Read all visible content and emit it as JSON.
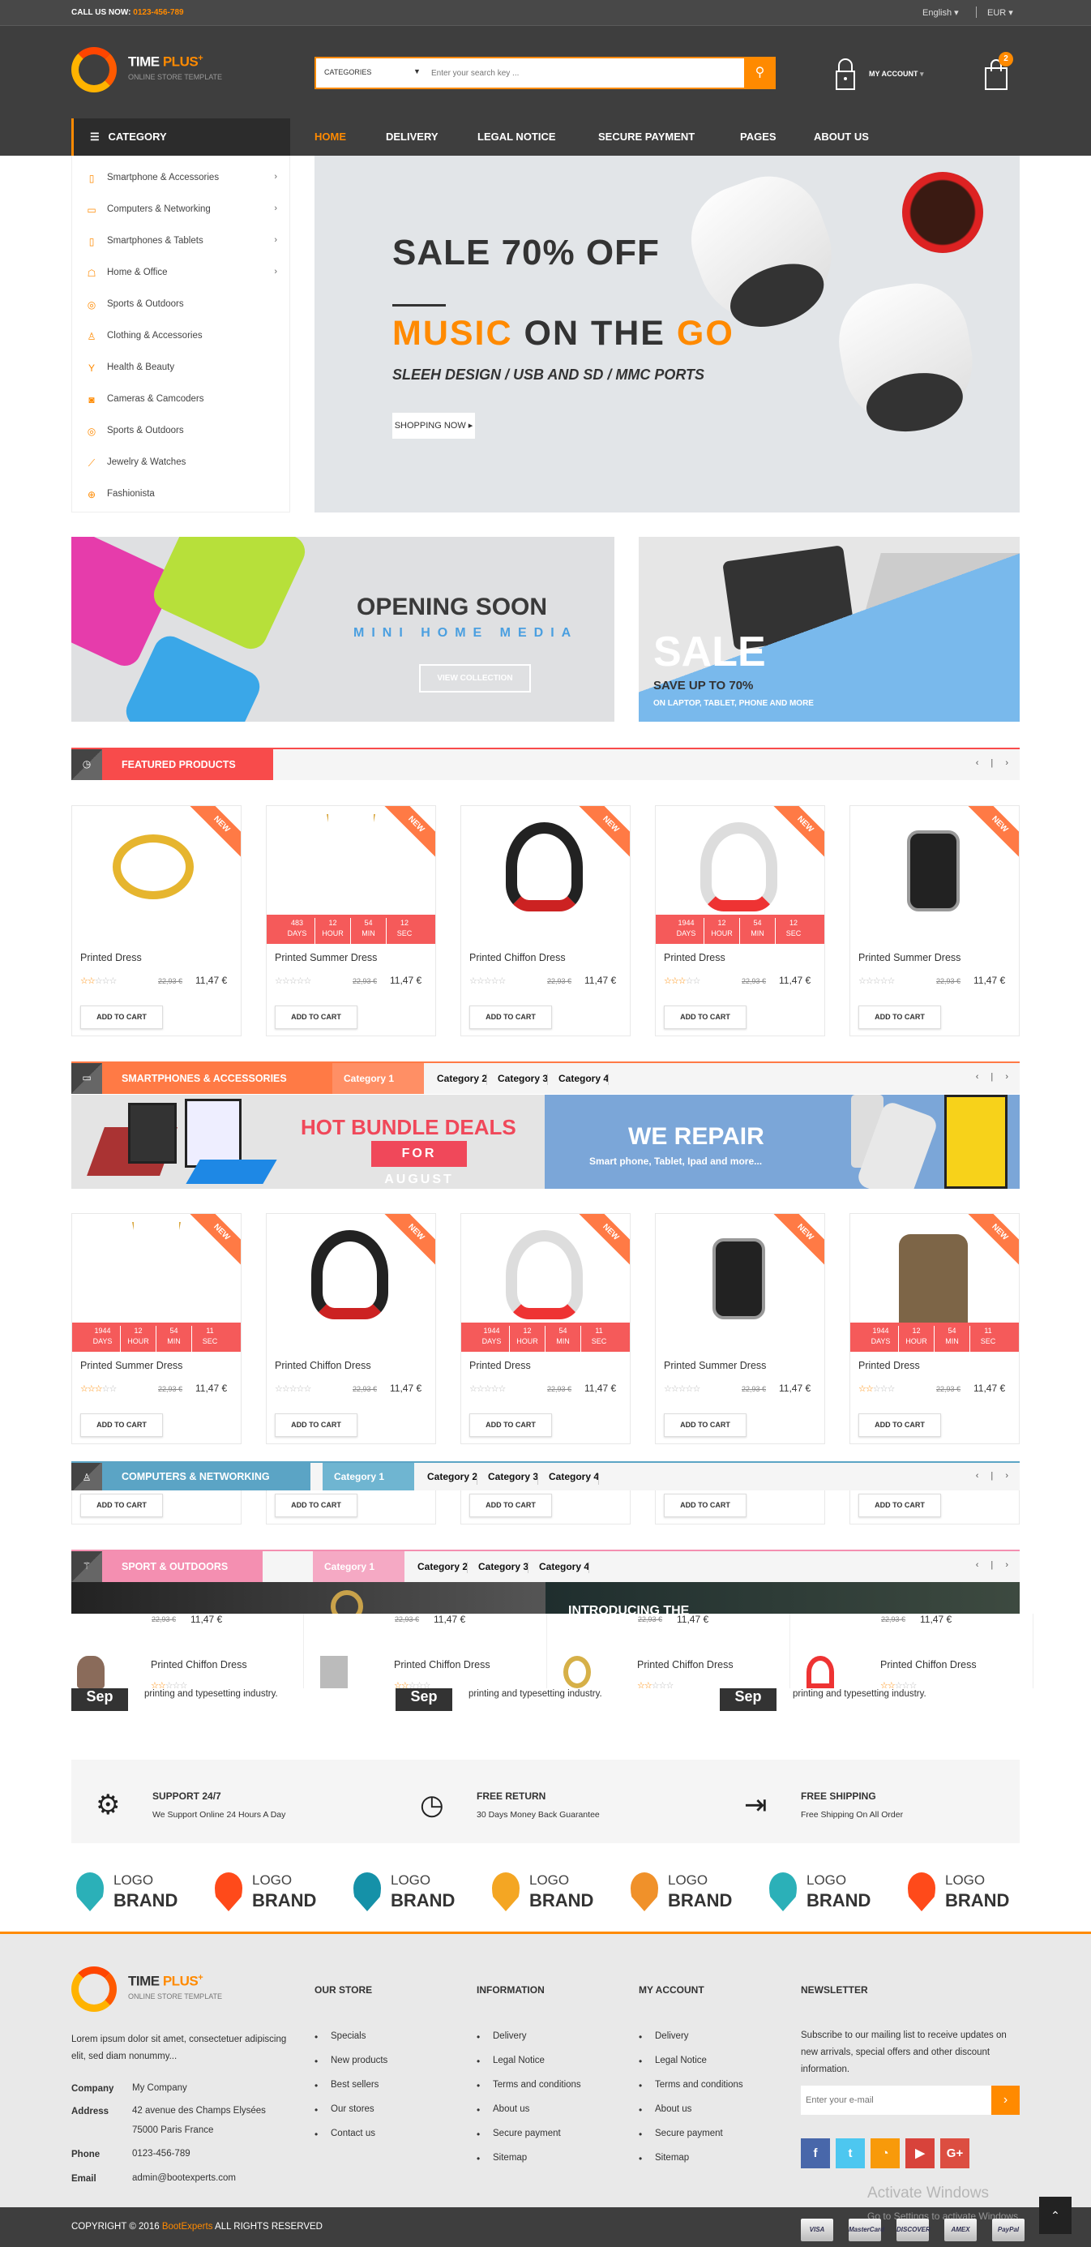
{
  "topbar": {
    "call_label": "CALL US NOW:",
    "phone": "0123-456-789",
    "language": "English",
    "currency": "EUR"
  },
  "header": {
    "logo": {
      "title_a": "TIME",
      "title_b": "PLUS",
      "plus": "+",
      "tagline": "ONLINE STORE TEMPLATE"
    },
    "search": {
      "category": "CATEGORIES",
      "placeholder": "Enter your search key ..."
    },
    "account_label": "MY ACCOUNT",
    "cart_count": "2"
  },
  "nav": {
    "category_label": "CATEGORY",
    "items": [
      "HOME",
      "DELIVERY",
      "LEGAL NOTICE",
      "SECURE PAYMENT",
      "PAGES",
      "ABOUT US"
    ],
    "active": "HOME"
  },
  "sidebar": {
    "items": [
      {
        "label": "Smartphone & Accessories",
        "icon": "smartphone-icon",
        "sub": true
      },
      {
        "label": "Computers & Networking",
        "icon": "monitor-icon",
        "sub": true
      },
      {
        "label": "Smartphones & Tablets",
        "icon": "tablet-icon",
        "sub": true
      },
      {
        "label": "Home & Office",
        "icon": "armchair-icon",
        "sub": true
      },
      {
        "label": "Sports & Outdoors",
        "icon": "target-icon",
        "sub": false
      },
      {
        "label": "Clothing & Accessories",
        "icon": "user-icon",
        "sub": false
      },
      {
        "label": "Health & Beauty",
        "icon": "cocktail-icon",
        "sub": false
      },
      {
        "label": "Cameras & Camcoders",
        "icon": "camera-icon",
        "sub": false
      },
      {
        "label": "Sports & Outdoors",
        "icon": "target-icon",
        "sub": false
      },
      {
        "label": "Jewelry & Watches",
        "icon": "wand-icon",
        "sub": false
      },
      {
        "label": "Fashionista",
        "icon": "plus-circle-icon",
        "sub": false
      }
    ]
  },
  "hero": {
    "line1": "SALE 70% OFF",
    "line2_a": "MUSIC",
    "line2_b": " ON THE ",
    "line2_c": "GO",
    "line3": "SLEEH DESIGN / USB AND SD / MMC PORTS",
    "button": "SHOPPING NOW"
  },
  "banners": {
    "left": {
      "title": "OPENING SOON",
      "subtitle": "MINI HOME MEDIA",
      "button": "VIEW COLLECTION"
    },
    "right": {
      "title": "SALE",
      "subtitle": "SAVE UP TO 70%",
      "text": "ON LAPTOP, TABLET, PHONE AND MORE"
    }
  },
  "featured": {
    "title": "FEATURED PRODUCTS",
    "products": [
      {
        "name": "Printed Dress",
        "rating": 2,
        "old_price": "22,93 €",
        "price": "11,47 €",
        "image": "ring",
        "badge": "NEW"
      },
      {
        "name": "Printed Summer Dress",
        "rating": 0,
        "old_price": "22,93 €",
        "price": "11,47 €",
        "image": "necklace",
        "badge": "NEW",
        "countdown": [
          "483",
          "12",
          "54",
          "12"
        ]
      },
      {
        "name": "Printed Chiffon Dress",
        "rating": 0,
        "old_price": "22,93 €",
        "price": "11,47 €",
        "image": "headphones-black",
        "badge": "NEW"
      },
      {
        "name": "Printed Dress",
        "rating": 3,
        "old_price": "22,93 €",
        "price": "11,47 €",
        "image": "headphones-red",
        "badge": "NEW",
        "countdown": [
          "1944",
          "12",
          "54",
          "12"
        ]
      },
      {
        "name": "Printed Summer Dress",
        "rating": 0,
        "old_price": "22,93 €",
        "price": "11,47 €",
        "image": "watch",
        "badge": "NEW"
      }
    ]
  },
  "countdown_units": [
    "DAYS",
    "HOUR",
    "MIN",
    "SEC"
  ],
  "add_to_cart": "ADD TO CART",
  "smartphones": {
    "title": "SMARTPHONES & ACCESSORIES",
    "tabs": [
      "Category 1",
      "Category 2",
      "Category 3",
      "Category 4"
    ],
    "banner_left": {
      "title": "HOT BUNDLE DEALS",
      "subtitle": "FOR AUGUST"
    },
    "banner_right": {
      "title": "WE REPAIR",
      "subtitle": "Smart phone, Tablet, Ipad and more..."
    },
    "products": [
      {
        "name": "Printed Summer Dress",
        "rating": 3,
        "old_price": "22,93 €",
        "price": "11,47 €",
        "image": "necklace",
        "badge": "NEW",
        "countdown": [
          "1944",
          "12",
          "54",
          "11"
        ]
      },
      {
        "name": "Printed Chiffon Dress",
        "rating": 0,
        "old_price": "22,93 €",
        "price": "11,47 €",
        "image": "headphones-black",
        "badge": "NEW"
      },
      {
        "name": "Printed Dress",
        "rating": 0,
        "old_price": "22,93 €",
        "price": "11,47 €",
        "image": "headphones-red",
        "badge": "NEW",
        "countdown": [
          "1944",
          "12",
          "54",
          "11"
        ]
      },
      {
        "name": "Printed Summer Dress",
        "rating": 0,
        "old_price": "22,93 €",
        "price": "11,47 €",
        "image": "watch",
        "badge": "NEW"
      },
      {
        "name": "Printed Dress",
        "rating": 2,
        "old_price": "22,93 €",
        "price": "11,47 €",
        "image": "backpack",
        "badge": "NEW",
        "countdown": [
          "1944",
          "12",
          "54",
          "11"
        ]
      }
    ]
  },
  "computers": {
    "title": "COMPUTERS & NETWORKING",
    "tabs": [
      "Category 1",
      "Category 2",
      "Category 3",
      "Category 4"
    ]
  },
  "sport": {
    "title": "SPORT & OUTDOORS",
    "tabs": [
      "Category 1",
      "Category 2",
      "Category 3",
      "Category 4"
    ],
    "strip_text": "INTRODUCING THE",
    "list": [
      {
        "name": "Printed Chiffon Dress",
        "rating": 2,
        "old_price": "22,93 €",
        "price": "11,47 €"
      },
      {
        "name": "Printed Chiffon Dress",
        "rating": 2,
        "old_price": "22,93 €",
        "price": "11,47 €"
      },
      {
        "name": "Printed Chiffon Dress",
        "rating": 2,
        "old_price": "22,93 €",
        "price": "11,47 €"
      },
      {
        "name": "Printed Chiffon Dress",
        "rating": 2,
        "old_price": "22,93 €",
        "price": "11,47 €"
      }
    ],
    "blog": [
      {
        "month": "Sep",
        "text": "printing and typesetting industry."
      },
      {
        "month": "Sep",
        "text": "printing and typesetting industry."
      },
      {
        "month": "Sep",
        "text": "printing and typesetting industry."
      }
    ]
  },
  "services": [
    {
      "title": "SUPPORT 24/7",
      "text": "We Support Online 24 Hours A Day",
      "icon": "gear-icon"
    },
    {
      "title": "FREE RETURN",
      "text": "30 Days Money Back Guarantee",
      "icon": "clock-icon"
    },
    {
      "title": "FREE SHIPPING",
      "text": "Free Shipping On All Order",
      "icon": "sign-in-icon"
    }
  ],
  "brands": {
    "line1": "LOGO",
    "line2": "BRAND",
    "count": 7
  },
  "footer": {
    "about": "Lorem ipsum dolor sit amet, consectetuer adipiscing elit, sed diam nonummy...",
    "company_label": "Company",
    "company": "My Company",
    "address_label": "Address",
    "address_1": "42 avenue des Champs Elysées",
    "address_2": "75000 Paris France",
    "phone_label": "Phone",
    "phone": "0123-456-789",
    "email_label": "Email",
    "email": "admin@bootexperts.com",
    "our_store": {
      "title": "OUR STORE",
      "items": [
        "Specials",
        "New products",
        "Best sellers",
        "Our stores",
        "Contact us"
      ]
    },
    "information": {
      "title": "INFORMATION",
      "items": [
        "Delivery",
        "Legal Notice",
        "Terms and conditions",
        "About us",
        "Secure payment",
        "Sitemap"
      ]
    },
    "my_account": {
      "title": "MY ACCOUNT",
      "items": [
        "Delivery",
        "Legal Notice",
        "Terms and conditions",
        "About us",
        "Secure payment",
        "Sitemap"
      ]
    },
    "newsletter": {
      "title": "NEWSLETTER",
      "text": "Subscribe to our mailing list to receive updates on new arrivals, special offers and other discount information.",
      "placeholder": "Enter your e-mail"
    },
    "social": [
      {
        "icon": "facebook-icon",
        "glyph": "f",
        "color": "#4867aa"
      },
      {
        "icon": "twitter-icon",
        "glyph": "t",
        "color": "#4dc7f0"
      },
      {
        "icon": "rss-icon",
        "glyph": "◔",
        "color": "#f89a0a"
      },
      {
        "icon": "youtube-icon",
        "glyph": "▶",
        "color": "#d8433b"
      },
      {
        "icon": "google-plus-icon",
        "glyph": "G+",
        "color": "#dc4e41"
      }
    ],
    "copyright_a": "COPYRIGHT © 2016 ",
    "copyright_brand": "BootExperts",
    "copyright_b": " ALL RIGHTS RESERVED",
    "payments": [
      "VISA",
      "MasterCard",
      "DISCOVER",
      "AMEX",
      "PayPal"
    ]
  },
  "watermark": {
    "line1": "Activate Windows",
    "line2": "Go to Settings to activate Windows."
  },
  "colors": {
    "accent": "#ff8a00",
    "featured": "#f84b4b",
    "smartphones": "#ff7a45",
    "computers": "#5ba4c5",
    "sport": "#f48fb1"
  }
}
